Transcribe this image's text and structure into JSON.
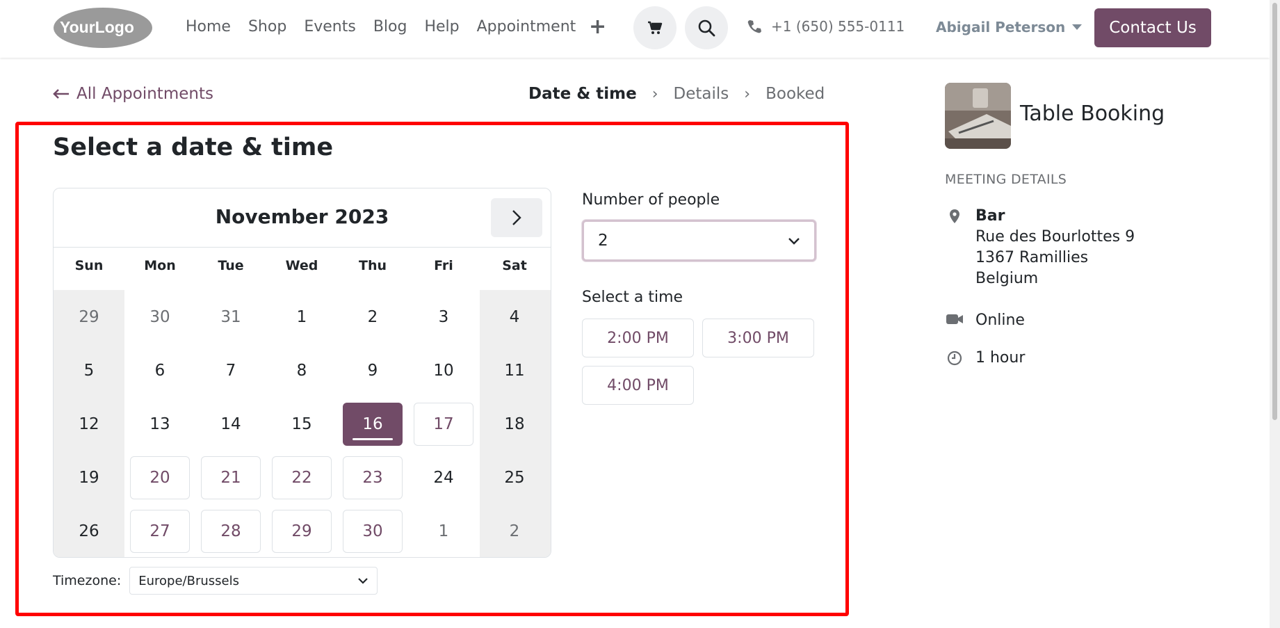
{
  "header": {
    "logo_text": "YourLogo",
    "nav": [
      "Home",
      "Shop",
      "Events",
      "Blog",
      "Help",
      "Appointment"
    ],
    "phone": "+1 (650) 555-0111",
    "user_name": "Abigail Peterson",
    "contact_label": "Contact Us"
  },
  "breadcrumb": {
    "back_label": "All Appointments",
    "steps": [
      "Date & time",
      "Details",
      "Booked"
    ]
  },
  "main": {
    "title": "Select a date & time",
    "calendar": {
      "month": "November 2023",
      "weekdays": [
        "Sun",
        "Mon",
        "Tue",
        "Wed",
        "Thu",
        "Fri",
        "Sat"
      ],
      "weeks": [
        [
          {
            "d": "29",
            "s": "muted"
          },
          {
            "d": "30",
            "s": "muted"
          },
          {
            "d": "31",
            "s": "muted"
          },
          {
            "d": "1",
            "s": "normal"
          },
          {
            "d": "2",
            "s": "normal"
          },
          {
            "d": "3",
            "s": "normal"
          },
          {
            "d": "4",
            "s": "normal"
          }
        ],
        [
          {
            "d": "5",
            "s": "normal"
          },
          {
            "d": "6",
            "s": "normal"
          },
          {
            "d": "7",
            "s": "normal"
          },
          {
            "d": "8",
            "s": "normal"
          },
          {
            "d": "9",
            "s": "normal"
          },
          {
            "d": "10",
            "s": "normal"
          },
          {
            "d": "11",
            "s": "normal"
          }
        ],
        [
          {
            "d": "12",
            "s": "normal"
          },
          {
            "d": "13",
            "s": "normal"
          },
          {
            "d": "14",
            "s": "normal"
          },
          {
            "d": "15",
            "s": "normal"
          },
          {
            "d": "16",
            "s": "selected"
          },
          {
            "d": "17",
            "s": "avail"
          },
          {
            "d": "18",
            "s": "normal"
          }
        ],
        [
          {
            "d": "19",
            "s": "normal"
          },
          {
            "d": "20",
            "s": "avail"
          },
          {
            "d": "21",
            "s": "avail"
          },
          {
            "d": "22",
            "s": "avail"
          },
          {
            "d": "23",
            "s": "avail"
          },
          {
            "d": "24",
            "s": "normal"
          },
          {
            "d": "25",
            "s": "normal"
          }
        ],
        [
          {
            "d": "26",
            "s": "normal"
          },
          {
            "d": "27",
            "s": "avail"
          },
          {
            "d": "28",
            "s": "avail"
          },
          {
            "d": "29",
            "s": "avail"
          },
          {
            "d": "30",
            "s": "avail"
          },
          {
            "d": "1",
            "s": "muted"
          },
          {
            "d": "2",
            "s": "muted"
          }
        ]
      ]
    },
    "timezone_label": "Timezone:",
    "timezone_value": "Europe/Brussels",
    "people_label": "Number of people",
    "people_value": "2",
    "time_label": "Select a time",
    "slots": [
      "2:00 PM",
      "3:00 PM",
      "4:00 PM"
    ]
  },
  "sidebar": {
    "title": "Table Booking",
    "details_label": "MEETING DETAILS",
    "location_name": "Bar",
    "address_lines": [
      "Rue des Bourlottes 9",
      "1367 Ramillies",
      "Belgium"
    ],
    "online_label": "Online",
    "duration": "1 hour"
  },
  "colors": {
    "brand": "#714b67",
    "highlight_frame": "#ff0000"
  }
}
